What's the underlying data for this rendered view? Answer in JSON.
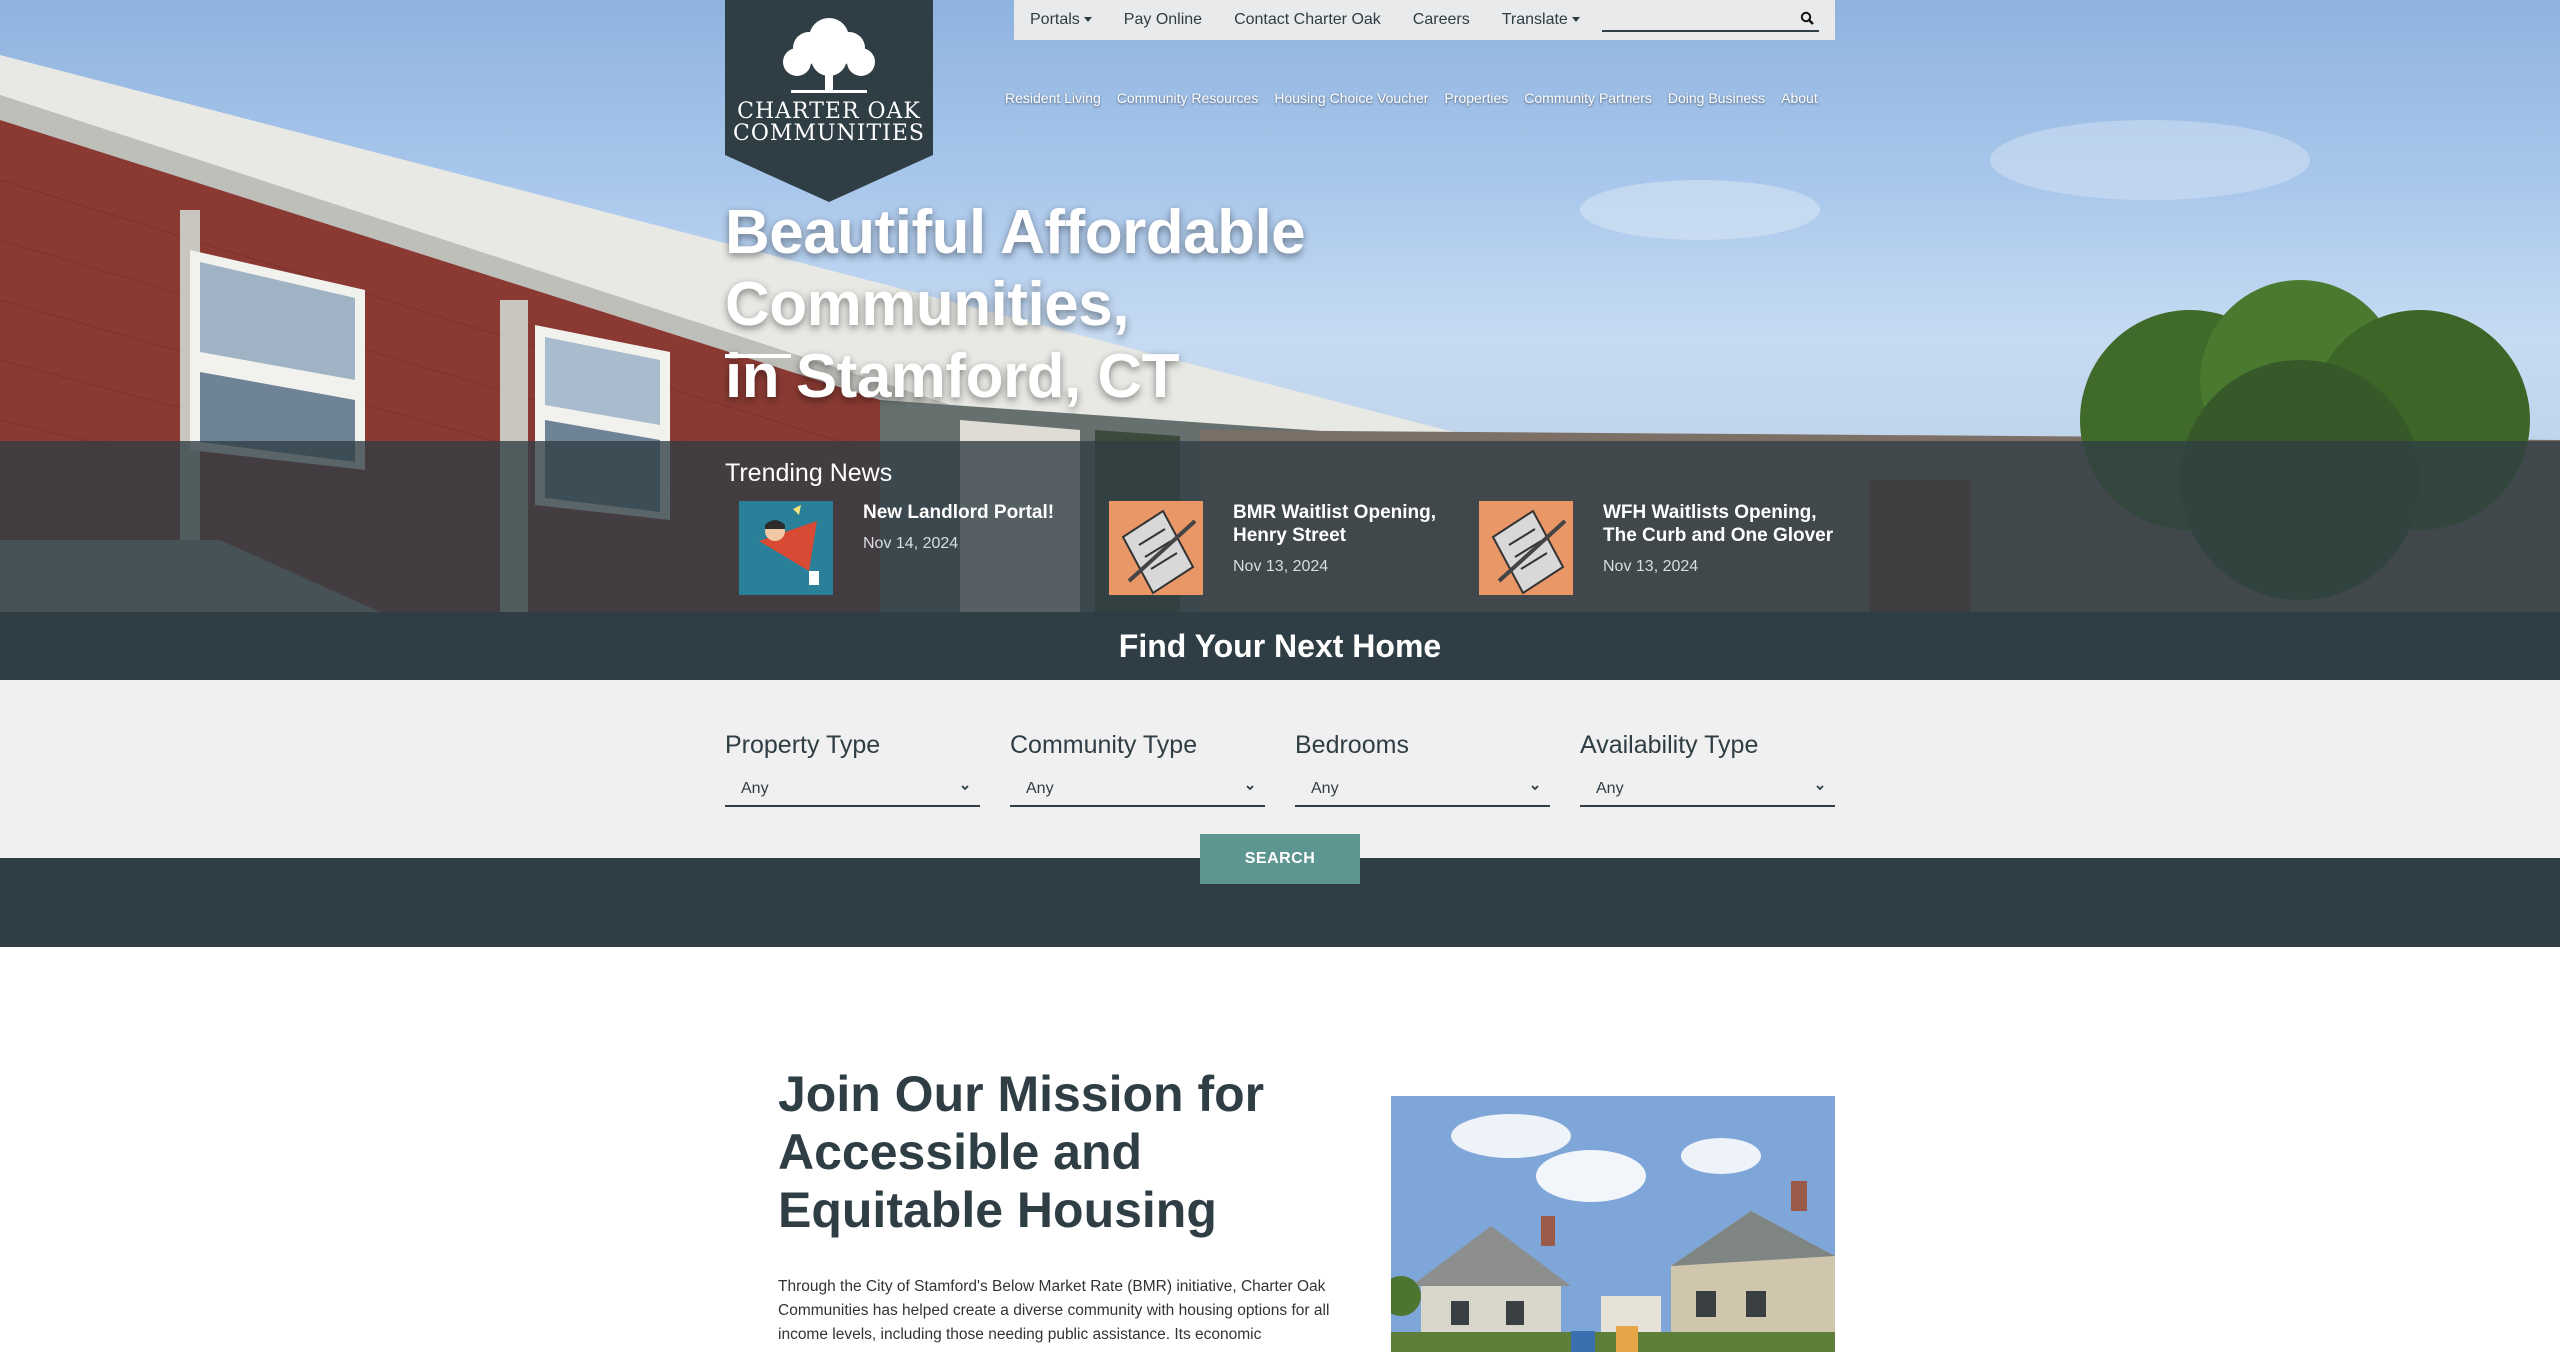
{
  "logo": {
    "line1": "CHARTER OAK",
    "line2": "COMMUNITIES"
  },
  "utility_nav": {
    "items": [
      {
        "label": "Portals",
        "dropdown": true
      },
      {
        "label": "Pay Online",
        "dropdown": false
      },
      {
        "label": "Contact Charter Oak",
        "dropdown": false
      },
      {
        "label": "Careers",
        "dropdown": false
      },
      {
        "label": "Translate",
        "dropdown": true
      }
    ],
    "search_placeholder": "",
    "search_icon": "search-icon"
  },
  "main_nav": {
    "items": [
      "Resident Living",
      "Community Resources",
      "Housing Choice Voucher",
      "Properties",
      "Community Partners",
      "Doing Business",
      "About"
    ]
  },
  "hero": {
    "headline_line1": "Beautiful Affordable Communities,",
    "headline_line2": "in Stamford, CT"
  },
  "trending": {
    "title": "Trending News",
    "items": [
      {
        "title": "New Landlord Portal!",
        "date": "Nov 14, 2024",
        "icon": "megaphone-person-icon"
      },
      {
        "title": "BMR Waitlist Opening, Henry Street",
        "date": "Nov 13, 2024",
        "icon": "clipboard-checklist-icon"
      },
      {
        "title": "WFH Waitlists Opening, The Curb and One Glover",
        "date": "Nov 13, 2024",
        "icon": "clipboard-checklist-icon"
      }
    ]
  },
  "find_home": {
    "title": "Find Your Next Home",
    "filters": [
      {
        "label": "Property Type",
        "value": "Any"
      },
      {
        "label": "Community Type",
        "value": "Any"
      },
      {
        "label": "Bedrooms",
        "value": "Any"
      },
      {
        "label": "Availability Type",
        "value": "Any"
      }
    ],
    "search_button": "SEARCH"
  },
  "mission": {
    "title": "Join Our Mission for Accessible and Equitable Housing",
    "text": "Through the City of Stamford's Below Market Rate (BMR) initiative, Charter Oak Communities has helped create a diverse community with housing options for all income levels, including those needing public assistance. Its economic"
  },
  "colors": {
    "dark_slate": "#2f3d44",
    "teal_button": "#5d9590",
    "panel_gray": "#f0f0f0",
    "news_thumb_blue": "#2a7f99",
    "news_thumb_orange": "#e99766"
  }
}
